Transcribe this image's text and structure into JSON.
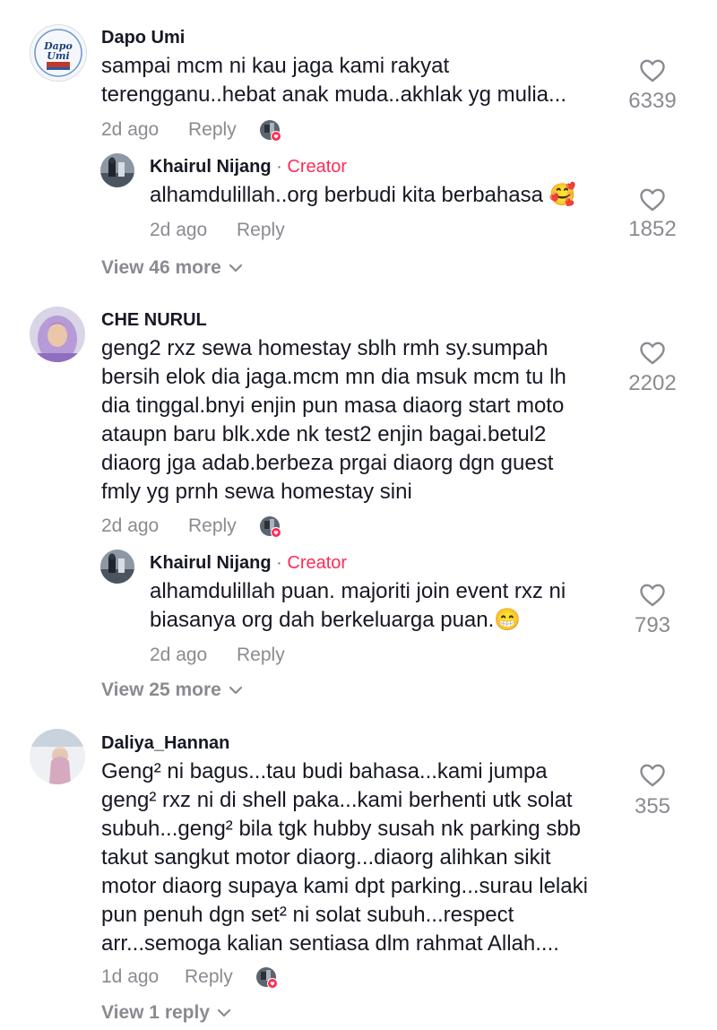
{
  "comments": [
    {
      "username": "Dapo Umi",
      "avatar_logo_text": "Dapo Umi",
      "lines": [
        "sampai mcm ni kau jaga kami rakyat",
        "terengganu..hebat anak muda..akhlak yg mulia..."
      ],
      "time": "2d ago",
      "reply_label": "Reply",
      "likes": "6339",
      "reply": {
        "username": "Khairul Nijang",
        "separator": "·",
        "creator_label": "Creator",
        "lines": [
          "alhamdulillah..org berbudi kita berbahasa 🥰"
        ],
        "time": "2d ago",
        "reply_label": "Reply",
        "likes": "1852"
      },
      "view_more": "View 46 more"
    },
    {
      "username": "CHE NURUL",
      "lines": [
        "geng2 rxz sewa homestay sblh rmh sy.sumpah",
        "bersih elok dia jaga.mcm mn dia msuk mcm tu lh",
        "dia tinggal.bnyi enjin pun masa diaorg start moto",
        "ataupn baru blk.xde nk test2 enjin bagai.betul2",
        "diaorg jga adab.berbeza prgai diaorg dgn guest",
        "fmly yg prnh sewa homestay sini"
      ],
      "time": "2d ago",
      "reply_label": "Reply",
      "likes": "2202",
      "reply": {
        "username": "Khairul Nijang",
        "separator": "·",
        "creator_label": "Creator",
        "lines": [
          "alhamdulillah puan. majoriti join event rxz ni",
          "biasanya org dah berkeluarga puan.😁"
        ],
        "time": "2d ago",
        "reply_label": "Reply",
        "likes": "793"
      },
      "view_more": "View 25 more"
    },
    {
      "username": "Daliya_Hannan",
      "lines": [
        "Geng² ni bagus...tau budi bahasa...kami jumpa",
        "geng² rxz ni di shell paka...kami berhenti utk solat",
        "subuh...geng² bila tgk hubby susah nk parking sbb",
        "takut sangkut motor diaorg...diaorg alihkan sikit",
        "motor diaorg supaya kami dpt parking...surau lelaki",
        "pun penuh dgn set² ni solat subuh...respect",
        "arr...semoga kalian sentiasa dlm rahmat Allah...."
      ],
      "time": "1d ago",
      "reply_label": "Reply",
      "likes": "355",
      "view_more": "View 1 reply"
    }
  ],
  "colors": {
    "text": "#161823",
    "secondary": "#8a8b91",
    "creator": "#fe2c55",
    "liked_badge": "#fe2c55"
  },
  "icons": [
    "heart-outline-icon",
    "chevron-down-icon",
    "creator-liked-badge-icon"
  ]
}
